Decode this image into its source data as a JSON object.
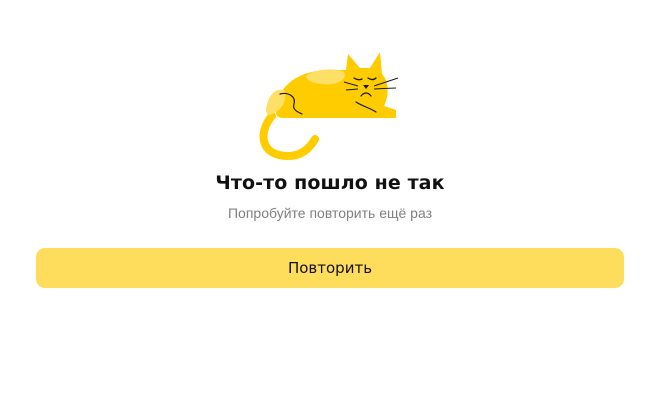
{
  "error": {
    "illustration_icon": "sad-cat-icon",
    "title": "Что-то пошло не так",
    "subtitle": "Попробуйте повторить ещё раз",
    "retry_label": "Повторить"
  },
  "colors": {
    "background": "#ffffff",
    "button": "#ffdd5c",
    "cat_body": "#ffcc00",
    "cat_spots": "#ffe066",
    "title_text": "#111111",
    "subtitle_text": "#808080"
  }
}
